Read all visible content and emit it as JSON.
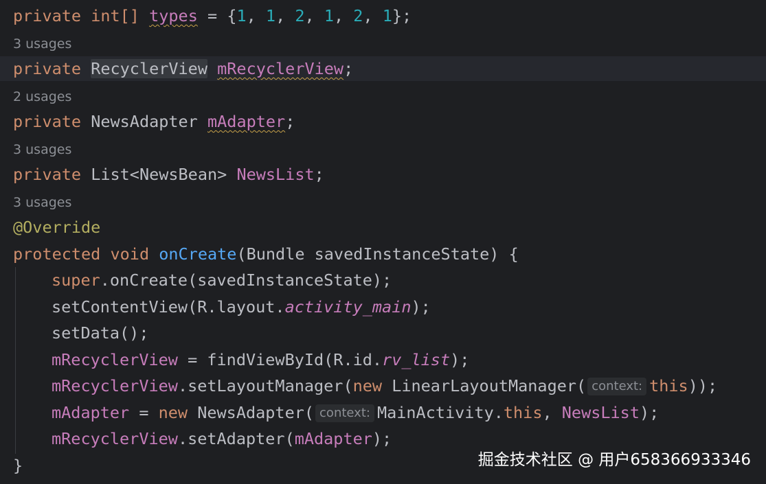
{
  "usages": {
    "mRecyclerView": "3 usages",
    "mAdapter": "2 usages",
    "NewsList": "3 usages",
    "onCreate": "3 usages"
  },
  "tokens": {
    "private": "private",
    "protected": "protected",
    "void": "void",
    "new": "new",
    "this": "this",
    "super": "super",
    "int_array": "int[]",
    "types": "types",
    "eq": " = ",
    "brace_open": "{",
    "brace_close": "}",
    "comma": ", ",
    "semi": ";",
    "RecyclerView": "RecyclerView",
    "mRecyclerView": "mRecyclerView",
    "NewsAdapter": "NewsAdapter",
    "mAdapter": "mAdapter",
    "List_NewsBean": "List<NewsBean>",
    "NewsList": "NewsList",
    "Override": "@Override",
    "onCreate": "onCreate",
    "Bundle_param": "(Bundle savedInstanceState) {",
    "dot_onCreate": ".onCreate(savedInstanceState);",
    "setContentView": "setContentView(R.layout.",
    "activity_main": "activity_main",
    "close_paren_semi": ");",
    "setData": "setData();",
    "findViewById": " = findViewById(R.id.",
    "rv_list": "rv_list",
    "setLayoutManager": ".setLayoutManager(",
    "LinearLayoutManager": " LinearLayoutManager(",
    "close_double": "));",
    "NewsAdapter_ctor": " NewsAdapter(",
    "MainActivity": "MainActivity.",
    "setAdapter": ".setAdapter(",
    "hint_context": "context:"
  },
  "numbers": [
    "1",
    "1",
    "2",
    "1",
    "2",
    "1"
  ],
  "watermark": "掘金技术社区 @ 用户658366933346",
  "colors": {
    "background": "#1e1f22",
    "keyword": "#cf8e6d",
    "field": "#c77dbb",
    "number": "#2aacb8",
    "method": "#56a8f5",
    "annotation": "#b3ae60",
    "text": "#bcbec4",
    "usages": "#8c8f95"
  }
}
